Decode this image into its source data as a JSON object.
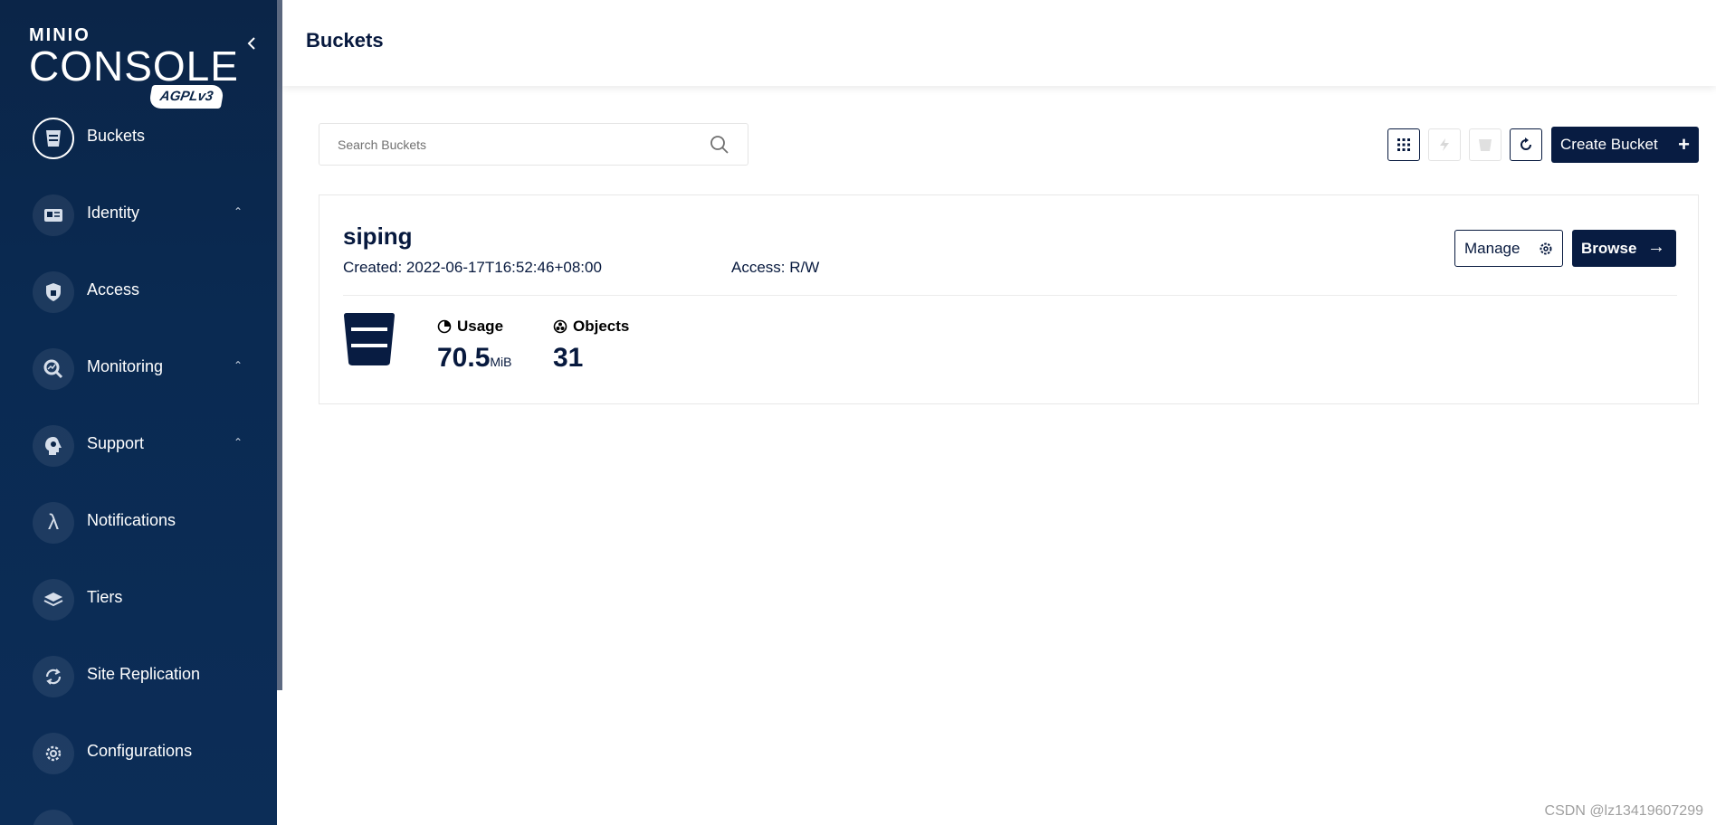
{
  "brand": {
    "minio": "MINIO",
    "console": "CONSOLE",
    "license": "AGPLv3"
  },
  "sidebar": {
    "items": [
      {
        "label": "Buckets",
        "icon": "bucket-icon",
        "active": true,
        "expandable": false
      },
      {
        "label": "Identity",
        "icon": "id-card-icon",
        "active": false,
        "expandable": true
      },
      {
        "label": "Access",
        "icon": "lock-shield-icon",
        "active": false,
        "expandable": false
      },
      {
        "label": "Monitoring",
        "icon": "magnifier-chart-icon",
        "active": false,
        "expandable": true
      },
      {
        "label": "Support",
        "icon": "support-head-icon",
        "active": false,
        "expandable": true
      },
      {
        "label": "Notifications",
        "icon": "lambda-icon",
        "active": false,
        "expandable": false
      },
      {
        "label": "Tiers",
        "icon": "layers-icon",
        "active": false,
        "expandable": false
      },
      {
        "label": "Site Replication",
        "icon": "replication-icon",
        "active": false,
        "expandable": false
      },
      {
        "label": "Configurations",
        "icon": "gear-icon",
        "active": false,
        "expandable": false
      }
    ]
  },
  "header": {
    "title": "Buckets"
  },
  "toolbar": {
    "search_placeholder": "Search Buckets",
    "create_label": "Create Bucket"
  },
  "buckets": [
    {
      "name": "siping",
      "created": "Created: 2022-06-17T16:52:46+08:00",
      "access": "Access: R/W",
      "manage_label": "Manage",
      "browse_label": "Browse",
      "usage_label": "Usage",
      "usage_value": "70.5",
      "usage_unit": "MiB",
      "objects_label": "Objects",
      "objects_value": "31"
    }
  ],
  "colors": {
    "navy": "#081c42",
    "sidebar": "#0b2548"
  },
  "watermark": "CSDN @lz13419607299"
}
